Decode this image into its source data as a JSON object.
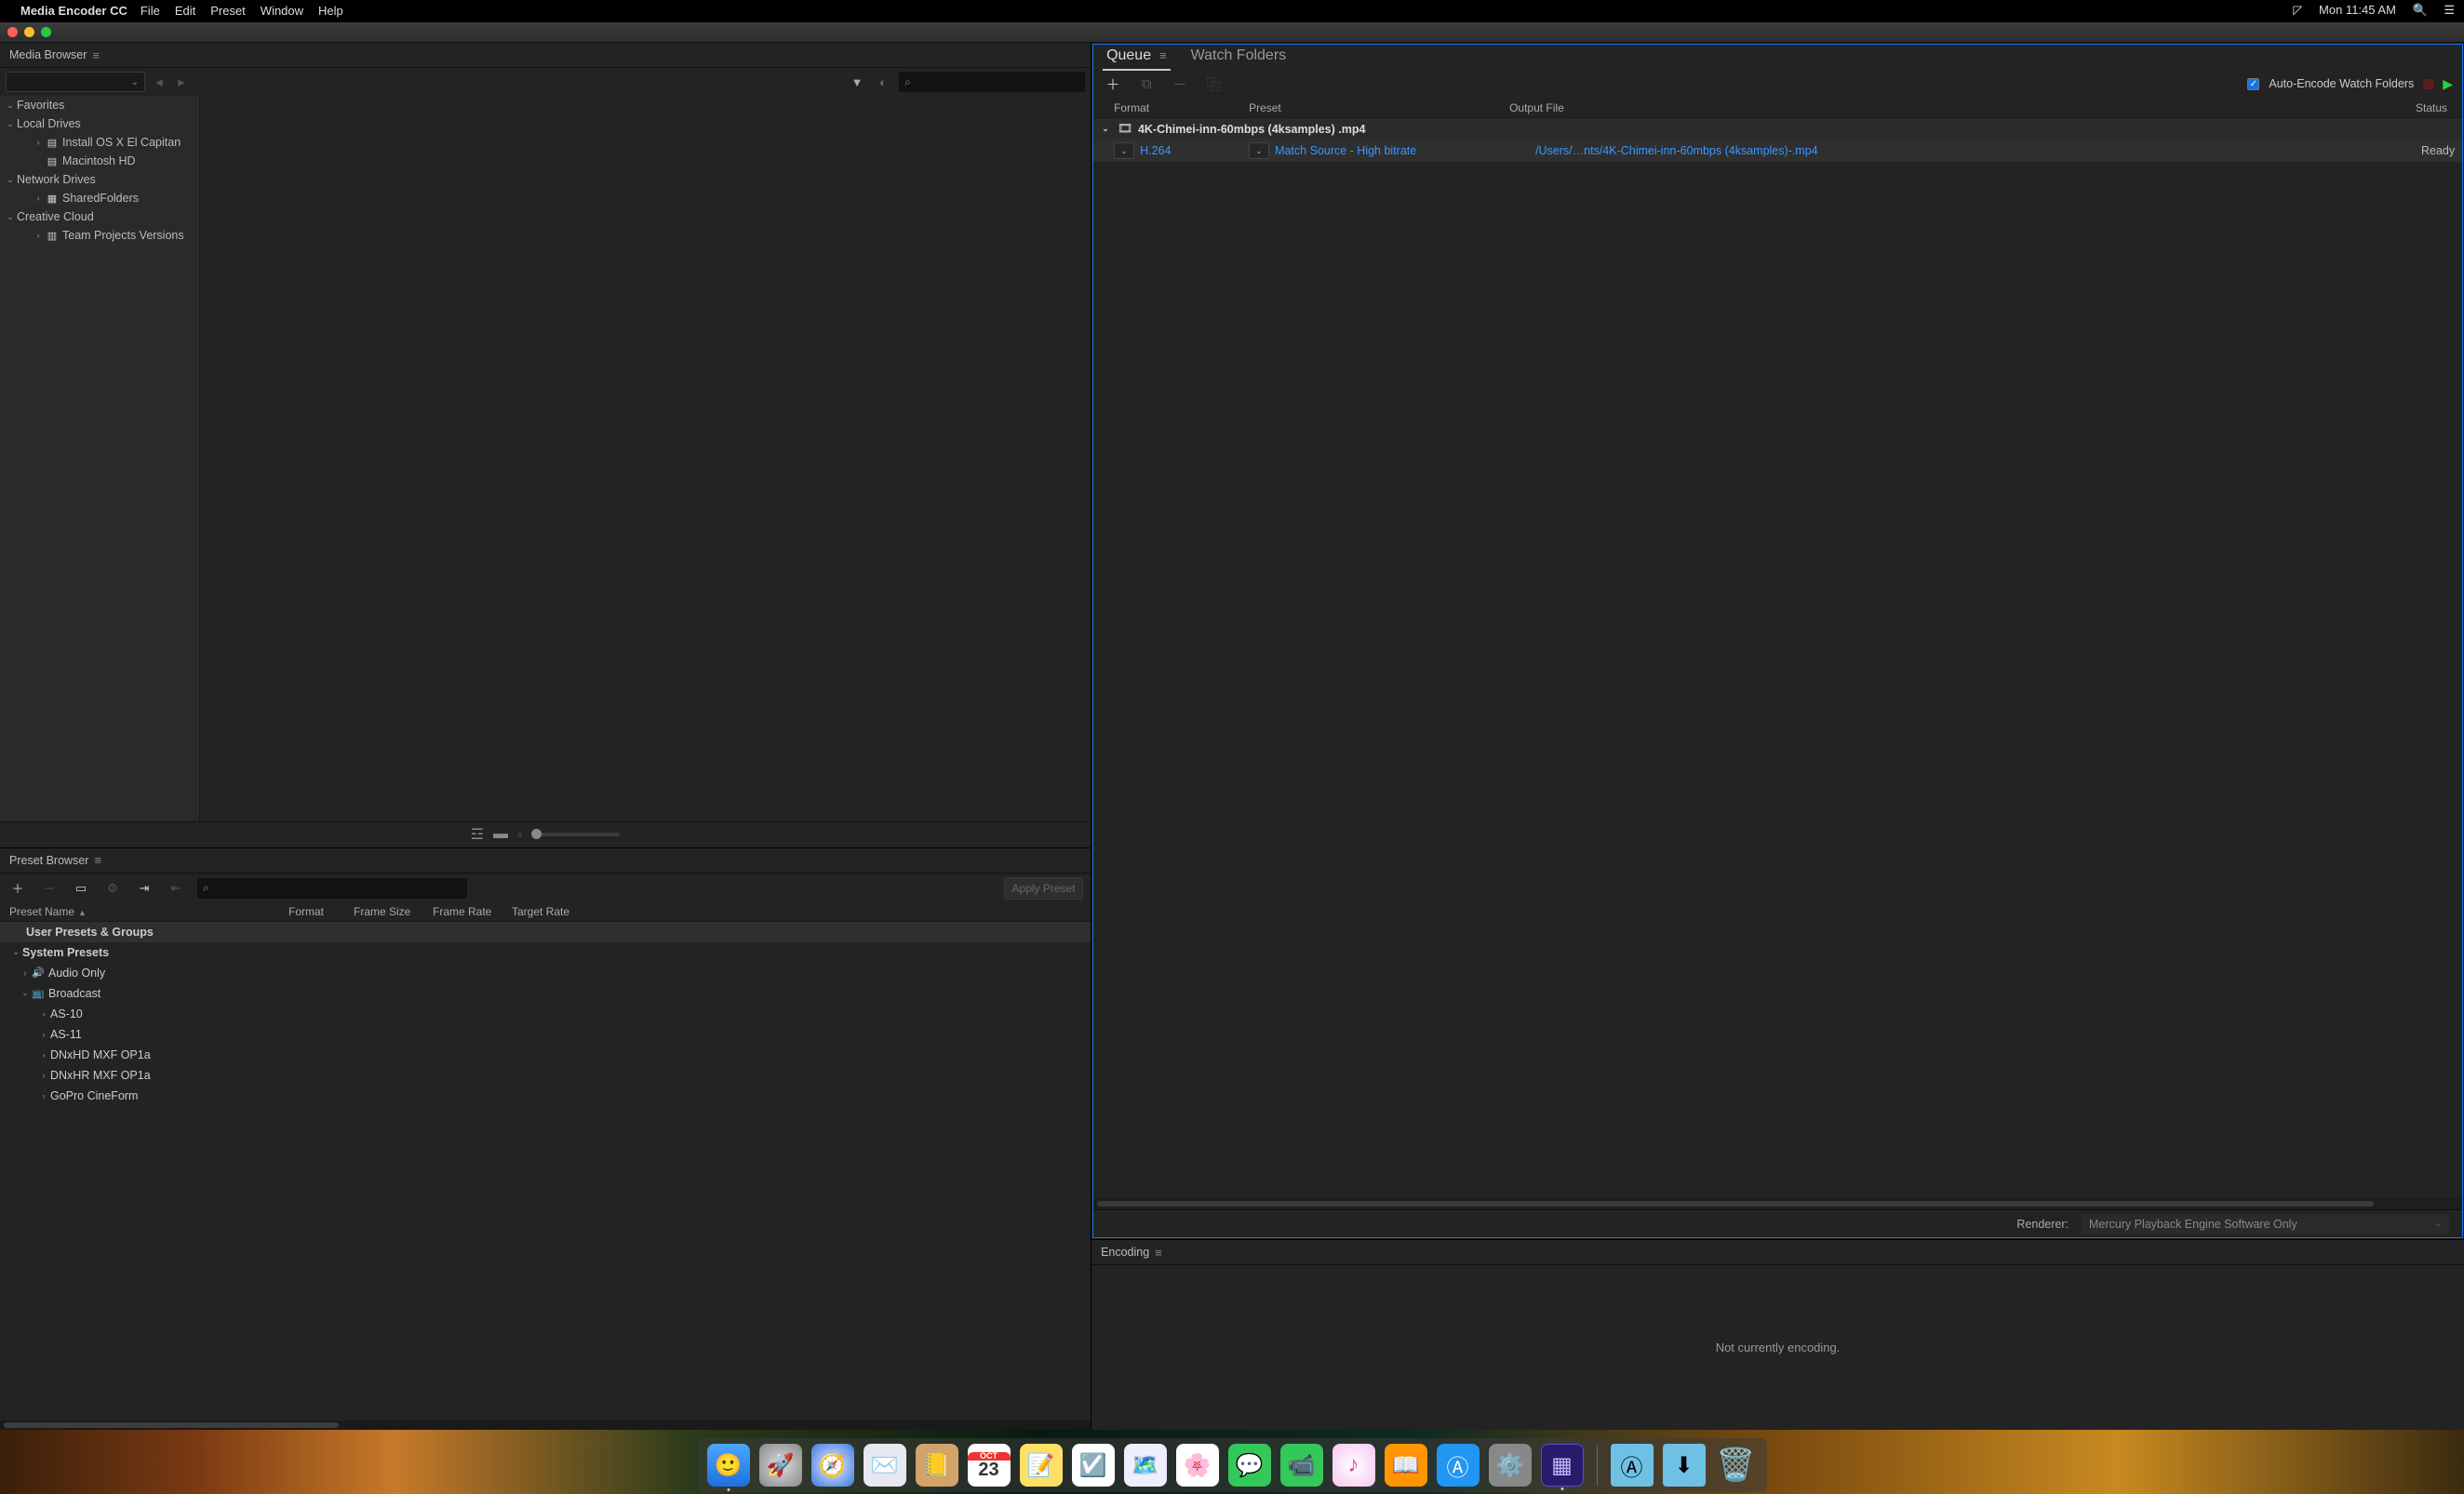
{
  "menubar": {
    "app": "Media Encoder CC",
    "items": [
      "File",
      "Edit",
      "Preset",
      "Window",
      "Help"
    ],
    "clock": "Mon 11:45 AM"
  },
  "media_browser": {
    "title": "Media Browser",
    "search_placeholder": "",
    "tree": {
      "favorites": "Favorites",
      "local_drives": "Local Drives",
      "drive1": "Install OS X El Capitan",
      "drive2": "Macintosh HD",
      "network": "Network Drives",
      "shared": "SharedFolders",
      "cc": "Creative Cloud",
      "teamproj": "Team Projects Versions"
    }
  },
  "preset_browser": {
    "title": "Preset Browser",
    "apply": "Apply Preset",
    "columns": {
      "name": "Preset Name",
      "format": "Format",
      "fsize": "Frame Size",
      "frate": "Frame Rate",
      "trate": "Target Rate"
    },
    "rows": {
      "user": "User Presets & Groups",
      "system": "System Presets",
      "audio": "Audio Only",
      "broadcast": "Broadcast",
      "as10": "AS-10",
      "as11": "AS-11",
      "dnxhd": "DNxHD MXF OP1a",
      "dnxhr": "DNxHR MXF OP1a",
      "gopro": "GoPro CineForm"
    }
  },
  "queue": {
    "tab_queue": "Queue",
    "tab_watch": "Watch Folders",
    "auto_encode": "Auto-Encode Watch Folders",
    "columns": {
      "format": "Format",
      "preset": "Preset",
      "output": "Output File",
      "status": "Status"
    },
    "source": "4K-Chimei-inn-60mbps (4ksamples) .mp4",
    "row": {
      "format": "H.264",
      "preset": "Match Source - High bitrate",
      "output": "/Users/…nts/4K-Chimei-inn-60mbps (4ksamples)-.mp4",
      "status": "Ready"
    },
    "renderer_label": "Renderer:",
    "renderer_value": "Mercury Playback Engine Software Only"
  },
  "encoding": {
    "title": "Encoding",
    "message": "Not currently encoding."
  },
  "dock": {
    "cal_month": "OCT",
    "cal_day": "23"
  }
}
